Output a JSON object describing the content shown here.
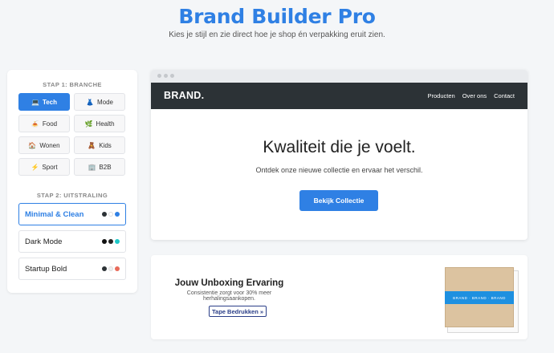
{
  "header": {
    "title": "Brand Builder Pro",
    "subtitle": "Kies je stijl en zie direct hoe je shop én verpakking eruit zien."
  },
  "sidebar": {
    "step1_label": "STAP 1: BRANCHE",
    "categories": [
      {
        "label": "Tech",
        "icon": "laptop-icon",
        "glyph": "💻",
        "active": true
      },
      {
        "label": "Mode",
        "icon": "dress-icon",
        "glyph": "👗",
        "active": false
      },
      {
        "label": "Food",
        "icon": "food-icon",
        "glyph": "🍝",
        "active": false
      },
      {
        "label": "Health",
        "icon": "leaf-icon",
        "glyph": "🌿",
        "active": false
      },
      {
        "label": "Wonen",
        "icon": "house-icon",
        "glyph": "🏠",
        "active": false
      },
      {
        "label": "Kids",
        "icon": "teddy-bear-icon",
        "glyph": "🧸",
        "active": false
      },
      {
        "label": "Sport",
        "icon": "lightning-icon",
        "glyph": "⚡",
        "active": false
      },
      {
        "label": "B2B",
        "icon": "building-icon",
        "glyph": "🏢",
        "active": false
      }
    ],
    "step2_label": "STAP 2: UITSTRALING",
    "styles": [
      {
        "label": "Minimal & Clean",
        "active": true,
        "swatches": [
          "#2c3236",
          "#ffffff",
          "#2f80e4"
        ]
      },
      {
        "label": "Dark Mode",
        "active": false,
        "swatches": [
          "#111111",
          "#222222",
          "#1ec8c8"
        ]
      },
      {
        "label": "Startup Bold",
        "active": false,
        "swatches": [
          "#2c3236",
          "#f0f0f0",
          "#e86a5a"
        ]
      }
    ]
  },
  "preview": {
    "logo": "BRAND.",
    "nav_links": [
      "Producten",
      "Over ons",
      "Contact"
    ],
    "hero_title": "Kwaliteit die je voelt.",
    "hero_subtitle": "Ontdek onze nieuwe collectie en ervaar het verschil.",
    "cta_label": "Bekijk Collectie",
    "accent_color": "#2f80e4"
  },
  "unboxing": {
    "title": "Jouw Unboxing Ervaring",
    "subtitle": "Consistentie zorgt voor 30% meer herhalingsaankopen.",
    "button_label": "Tape Bedrukken »",
    "tape_text": "BRAND · BRAND · BRAND"
  }
}
